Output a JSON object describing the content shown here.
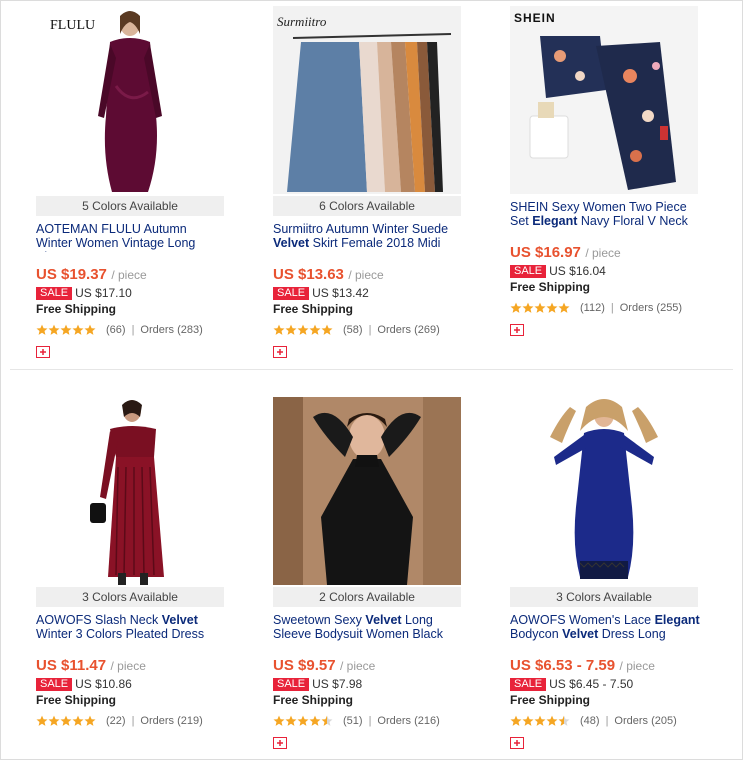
{
  "products": [
    {
      "brand_mark": "FLULU",
      "colors_available": "5 Colors Available",
      "title_html": "AOTEMAN FLULU Autumn Winter Women Vintage Long Sleeve",
      "price": "US $19.37",
      "unit": "/ piece",
      "sale_badge": "SALE",
      "sale_price": "US $17.10",
      "shipping": "Free Shipping",
      "rating": 5,
      "reviews": "(66)",
      "orders": "Orders (283)"
    },
    {
      "brand_mark": "Surmiitro",
      "colors_available": "6 Colors Available",
      "title_parts": [
        "Surmiitro Autumn Winter Suede ",
        "Velvet",
        " Skirt Female 2018 Midi"
      ],
      "price": "US $13.63",
      "unit": "/ piece",
      "sale_badge": "SALE",
      "sale_price": "US $13.42",
      "shipping": "Free Shipping",
      "rating": 5,
      "reviews": "(58)",
      "orders": "Orders (269)"
    },
    {
      "brand_mark": "SHEIN",
      "title_parts": [
        "SHEIN Sexy Women Two Piece Set ",
        "Elegant",
        " Navy Floral V Neck"
      ],
      "price": "US $16.97",
      "unit": "/ piece",
      "sale_badge": "SALE",
      "sale_price": "US $16.04",
      "shipping": "Free Shipping",
      "rating": 5,
      "reviews": "(112)",
      "orders": "Orders (255)"
    },
    {
      "colors_available": "3 Colors Available",
      "title_parts": [
        "AOWOFS Slash Neck ",
        "Velvet",
        " Winter 3 Colors Pleated Dress"
      ],
      "price": "US $11.47",
      "unit": "/ piece",
      "sale_badge": "SALE",
      "sale_price": "US $10.86",
      "shipping": "Free Shipping",
      "rating": 5,
      "reviews": "(22)",
      "orders": "Orders (219)"
    },
    {
      "colors_available": "2 Colors Available",
      "title_parts": [
        "Sweetown Sexy ",
        "Velvet",
        " Long Sleeve Bodysuit Women Black"
      ],
      "price": "US $9.57",
      "unit": "/ piece",
      "sale_badge": "SALE",
      "sale_price": "US $7.98",
      "shipping": "Free Shipping",
      "rating": 4.5,
      "reviews": "(51)",
      "orders": "Orders (216)"
    },
    {
      "colors_available": "3 Colors Available",
      "title_parts": [
        "AOWOFS Women's Lace ",
        "Elegant",
        " Bodycon ",
        "Velvet",
        " Dress Long"
      ],
      "price": "US $6.53 - 7.59",
      "unit": "/ piece",
      "sale_badge": "SALE",
      "sale_price": "US $6.45 - 7.50",
      "shipping": "Free Shipping",
      "rating": 4.5,
      "reviews": "(48)",
      "orders": "Orders (205)"
    }
  ],
  "colors": {
    "price": "#e8522f",
    "sale_badge": "#e8233a",
    "title": "#0b2a7a",
    "star": "#f5a623"
  },
  "icons": {
    "rating": "star-icon",
    "store": "store-coupon-icon"
  }
}
